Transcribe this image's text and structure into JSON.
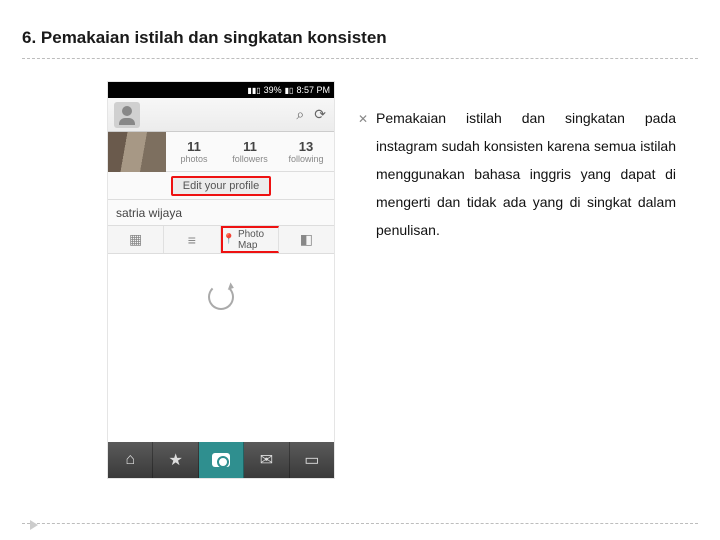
{
  "heading": "6. Pemakaian istilah dan singkatan konsisten",
  "bullet_glyph": "✕",
  "paragraph": "Pemakaian istilah dan singkatan pada instagram sudah konsisten karena semua istilah menggunakan bahasa inggris yang dapat di mengerti dan tidak ada yang di singkat dalam penulisan.",
  "phone": {
    "status": {
      "signal": "▮▮▯",
      "battery": "39%",
      "time": "8:57 PM",
      "bat_icon": "▮▯"
    },
    "stats": {
      "photos": {
        "n": "11",
        "label": "photos"
      },
      "followers": {
        "n": "11",
        "label": "followers"
      },
      "following": {
        "n": "13",
        "label": "following"
      }
    },
    "edit_label": "Edit your profile",
    "username": "satria wijaya",
    "tabs": {
      "grid": "▦",
      "list": "≡",
      "photo_map_icon": "📍",
      "photo_map": "Photo Map",
      "tag": "◧"
    },
    "top_icons": {
      "search": "⌕",
      "refresh": "⟳"
    },
    "bottom": {
      "home": "⌂",
      "star": "★",
      "chat": "✉",
      "news": "▭"
    }
  }
}
